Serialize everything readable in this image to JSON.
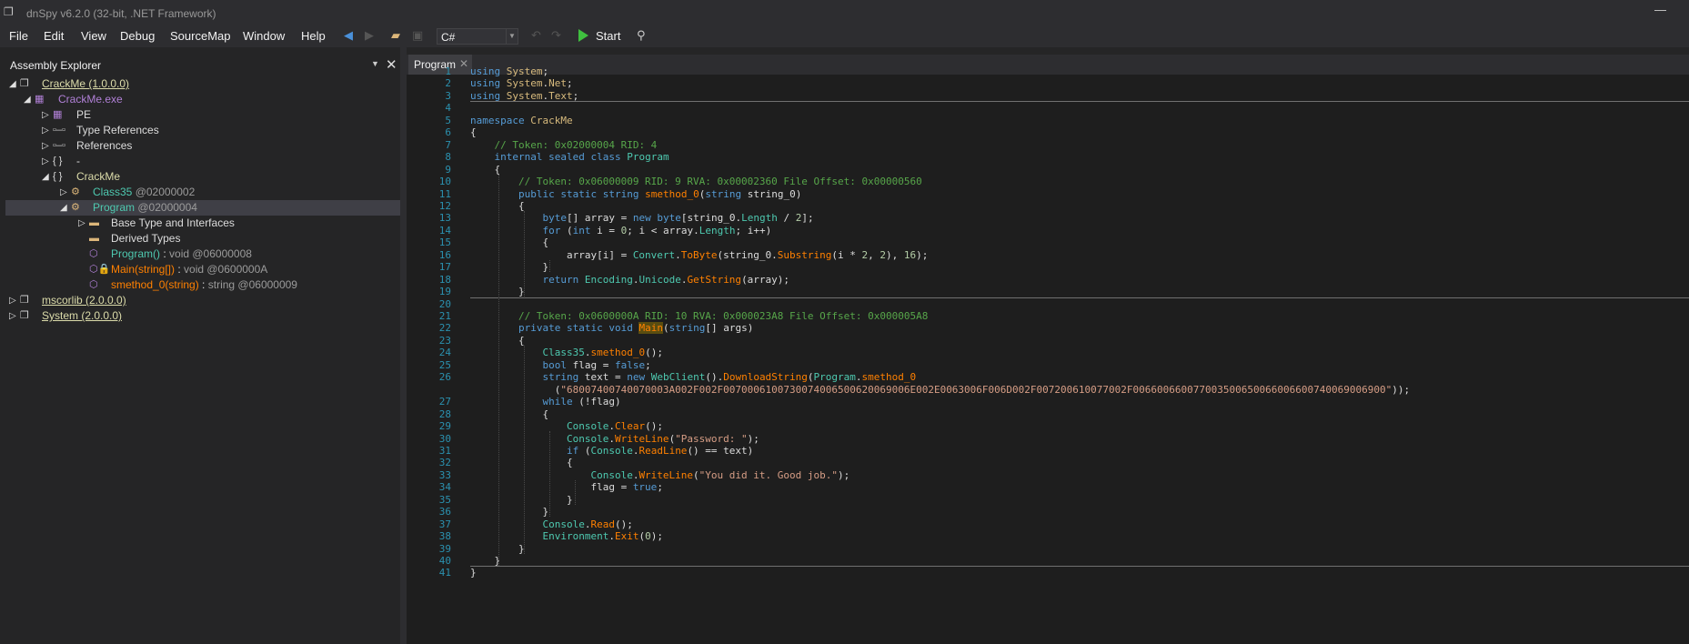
{
  "window": {
    "title": "dnSpy v6.2.0 (32-bit, .NET Framework)"
  },
  "menu": [
    "File",
    "Edit",
    "View",
    "Debug",
    "SourceMap",
    "Window",
    "Help"
  ],
  "toolbar": {
    "language": "C#",
    "start_label": "Start"
  },
  "assembly_explorer": {
    "title": "Assembly Explorer",
    "tree": [
      {
        "label": "CrackMe (1.0.0.0)",
        "suffix": "",
        "sep": ""
      },
      {
        "label": "CrackMe.exe",
        "suffix": "",
        "sep": ""
      },
      {
        "label": "PE",
        "suffix": "",
        "sep": ""
      },
      {
        "label": "Type References",
        "suffix": "",
        "sep": ""
      },
      {
        "label": "References",
        "suffix": "",
        "sep": ""
      },
      {
        "label": "-",
        "suffix": "",
        "sep": ""
      },
      {
        "label": "CrackMe",
        "suffix": "",
        "sep": ""
      },
      {
        "label": "Class35",
        "suffix": "@02000002",
        "sep": ""
      },
      {
        "label": "Program",
        "suffix": "@02000004",
        "sep": ""
      },
      {
        "label": "Base Type and Interfaces",
        "suffix": "",
        "sep": ""
      },
      {
        "label": "Derived Types",
        "suffix": "",
        "sep": ""
      },
      {
        "label": "Program()",
        "suffix": "void @06000008",
        "sep": " : "
      },
      {
        "label": "Main(string[])",
        "suffix": "void @0600000A",
        "sep": " : "
      },
      {
        "label": "smethod_0(string)",
        "suffix": "string @06000009",
        "sep": " : "
      },
      {
        "label": "mscorlib (2.0.0.0)",
        "suffix": "",
        "sep": ""
      },
      {
        "label": "System (2.0.0.0)",
        "suffix": "",
        "sep": ""
      }
    ]
  },
  "editor": {
    "tab": "Program",
    "line_numbers": [
      "1",
      "2",
      "3",
      "4",
      "5",
      "6",
      "7",
      "8",
      "9",
      "10",
      "11",
      "12",
      "13",
      "14",
      "15",
      "16",
      "17",
      "18",
      "19",
      "20",
      "21",
      "22",
      "23",
      "24",
      "25",
      "26",
      "27",
      "28",
      "29",
      "30",
      "31",
      "32",
      "33",
      "34",
      "35",
      "36",
      "37",
      "38",
      "39",
      "40",
      "41"
    ],
    "lines": [
      "using System;",
      "using System.Net;",
      "using System.Text;",
      "",
      "namespace CrackMe",
      "{",
      "    // Token: 0x02000004 RID: 4",
      "    internal sealed class Program",
      "    {",
      "        // Token: 0x06000009 RID: 9 RVA: 0x00002360 File Offset: 0x00000560",
      "        public static string smethod_0(string string_0)",
      "        {",
      "            byte[] array = new byte[string_0.Length / 2];",
      "            for (int i = 0; i < array.Length; i++)",
      "            {",
      "                array[i] = Convert.ToByte(string_0.Substring(i * 2, 2), 16);",
      "            }",
      "            return Encoding.Unicode.GetString(array);",
      "        }",
      "",
      "        // Token: 0x0600000A RID: 10 RVA: 0x000023A8 File Offset: 0x000005A8",
      "        private static void Main(string[] args)",
      "        {",
      "            Class35.smethod_0();",
      "            bool flag = false;",
      "            string text = new WebClient().DownloadString(Program.smethod_0",
      "              (\"68007400740070003A002F002F0070006100730074006500620069006E002E0063006F006D002F007200610077002F006600660077003500650066006600740069006900\"));",
      "            while (!flag)",
      "            {",
      "                Console.Clear();",
      "                Console.WriteLine(\"Password: \");",
      "                if (Console.ReadLine() == text)",
      "                {",
      "                    Console.WriteLine(\"You did it. Good job.\");",
      "                    flag = true;",
      "                }",
      "            }",
      "            Console.Read();",
      "            Environment.Exit(0);",
      "        }",
      "    }",
      "}"
    ]
  }
}
